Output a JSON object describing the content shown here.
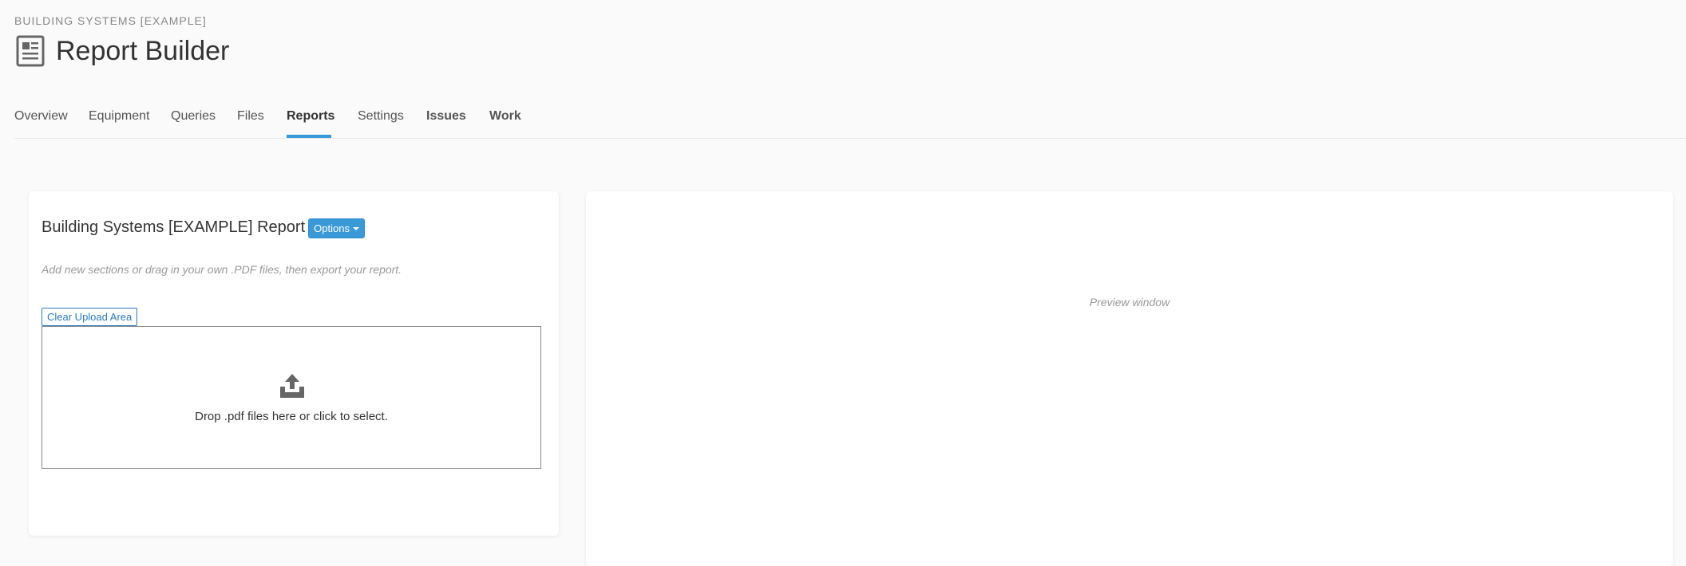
{
  "header": {
    "eyebrow": "BUILDING SYSTEMS [EXAMPLE]",
    "title": "Report Builder",
    "title_icon": "report-document-icon"
  },
  "tabs": [
    {
      "label": "Overview"
    },
    {
      "label": "Equipment"
    },
    {
      "label": "Queries"
    },
    {
      "label": "Files"
    },
    {
      "label": "Reports"
    },
    {
      "label": "Settings"
    },
    {
      "label": "Issues"
    },
    {
      "label": "Work"
    }
  ],
  "active_tab": "Reports",
  "builder": {
    "report_title": "Building Systems [EXAMPLE] Report",
    "options_label": "Options",
    "hint": "Add new sections or drag in your own .PDF files, then export your report.",
    "clear_label": "Clear Upload Area",
    "drop_text": "Drop .pdf files here or click to select.",
    "upload_icon": "upload-tray-icon"
  },
  "preview": {
    "text": "Preview window"
  },
  "colors": {
    "accent": "#3a9ad9",
    "link": "#2a7bbf",
    "background": "#fafafa"
  }
}
